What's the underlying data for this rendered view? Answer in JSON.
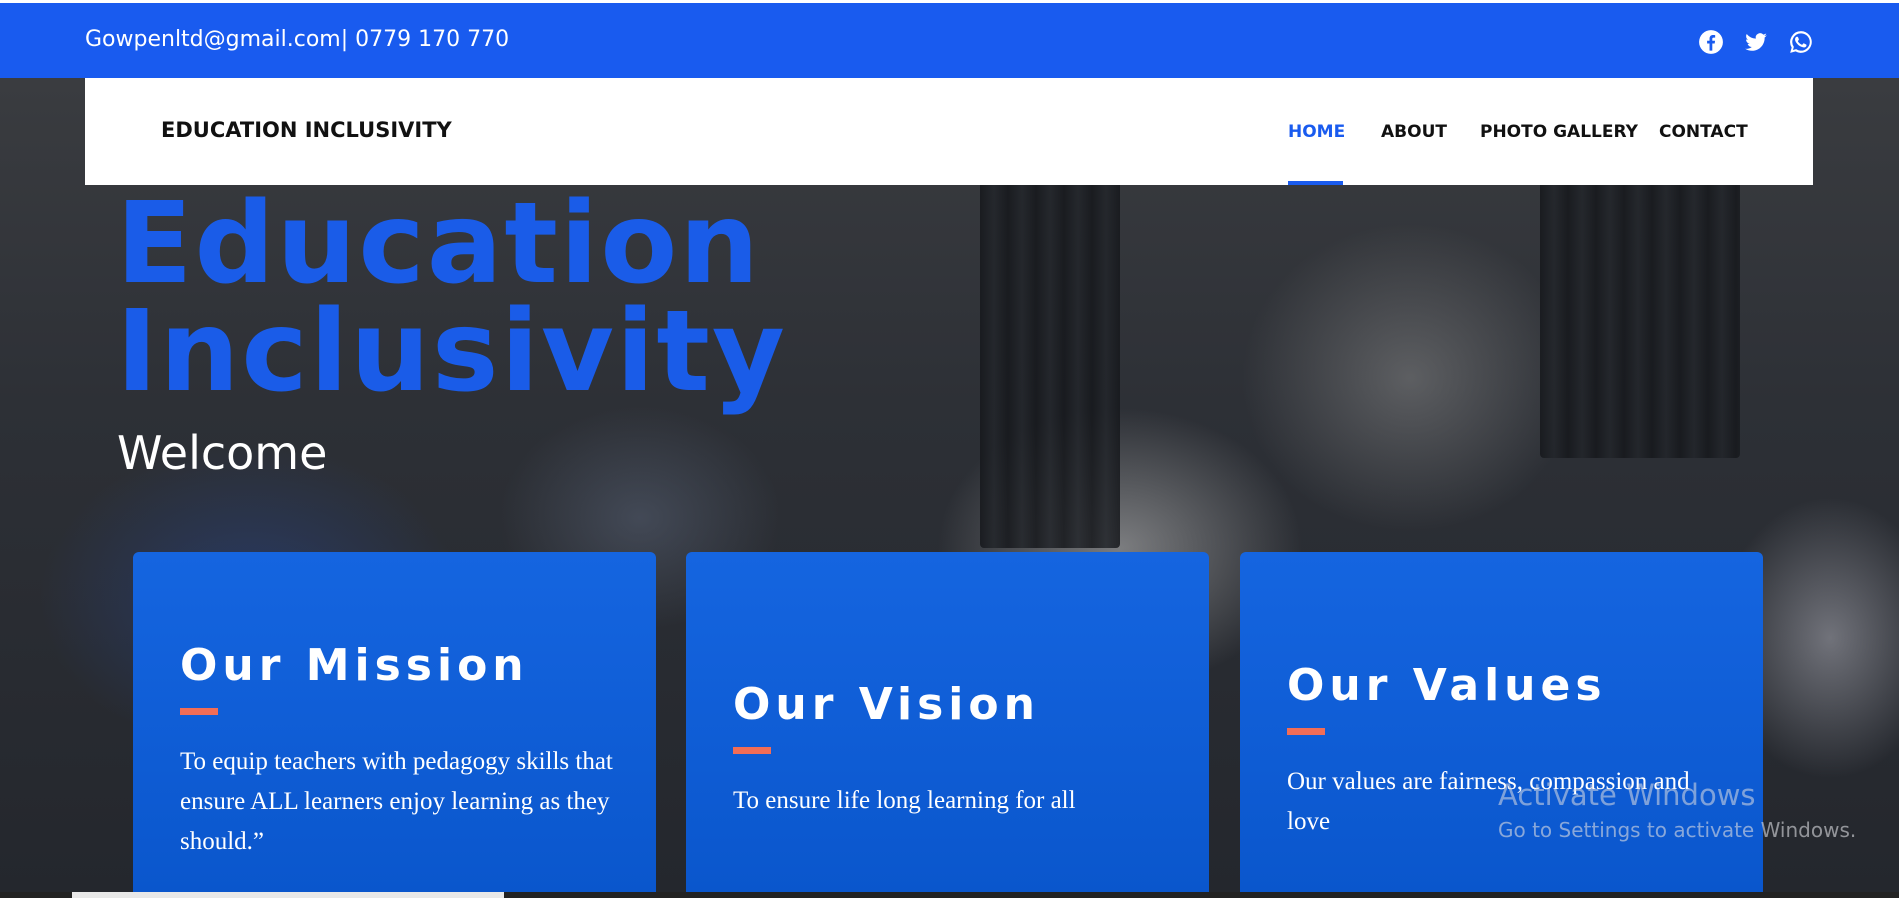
{
  "topbar": {
    "contact": "Gowpenltd@gmail.com| 0779 170 770",
    "social": [
      "facebook-icon",
      "twitter-icon",
      "whatsapp-icon"
    ],
    "bg_color": "#195bef"
  },
  "nav": {
    "brand": "EDUCATION INCLUSIVITY",
    "items": [
      {
        "label": "HOME",
        "active": true
      },
      {
        "label": "ABOUT",
        "active": false
      },
      {
        "label": "PHOTO GALLERY",
        "active": false
      },
      {
        "label": "CONTACT",
        "active": false
      }
    ],
    "accent_color": "#195bef"
  },
  "hero": {
    "title_line1": "Education",
    "title_line2": "Inclusivity",
    "subtitle": "Welcome"
  },
  "cards": [
    {
      "title": "Our Mission",
      "text": "To equip teachers with pedagogy skills that ensure ALL learners enjoy learning as they should.”"
    },
    {
      "title": "Our Vision",
      "text": "To ensure life long learning for all"
    },
    {
      "title": "Our Values",
      "text": "Our values are fairness, compassion and love"
    }
  ],
  "card_accent_color": "#f26d56",
  "watermark": {
    "title": "Activate Windows",
    "subtitle": "Go to Settings to activate Windows."
  }
}
